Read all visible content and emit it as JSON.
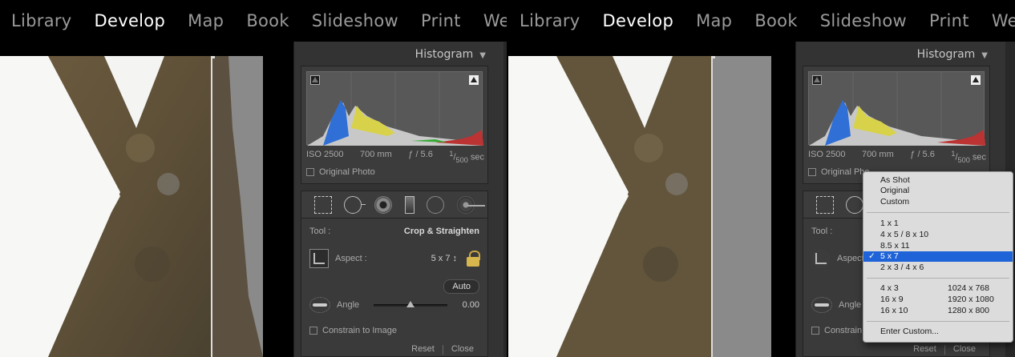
{
  "modules": [
    "Library",
    "Develop",
    "Map",
    "Book",
    "Slideshow",
    "Print",
    "Web"
  ],
  "active_module": "Develop",
  "histogram": {
    "title": "Histogram",
    "iso": "ISO 2500",
    "focal": "700 mm",
    "aperture": "ƒ / 5.6",
    "shutter_num": "1",
    "shutter_den": "500",
    "shutter_unit": "sec",
    "original_photo": "Original Photo"
  },
  "crop": {
    "tool_label": "Tool :",
    "tool_value": "Crop & Straighten",
    "aspect_label": "Aspect :",
    "aspect_value": "5 x 7 ↕",
    "auto_label": "Auto",
    "angle_label": "Angle",
    "angle_value": "0.00",
    "constrain_label": "Constrain to Image",
    "angle_fraction": 0.5
  },
  "footer": {
    "reset": "Reset",
    "close": "Close"
  },
  "aspect_menu": {
    "group1": [
      "As Shot",
      "Original",
      "Custom"
    ],
    "group2": [
      "1 x 1",
      "4 x 5  /  8 x 10",
      "8.5 x 11",
      "5 x 7",
      "2 x 3  /  4 x 6"
    ],
    "selected": "5 x 7",
    "group3_left": [
      "4 x 3",
      "16 x 9",
      "16 x 10"
    ],
    "group3_right": [
      "1024 x 768",
      "1920 x 1080",
      "1280 x 800"
    ],
    "enter_custom": "Enter Custom...",
    "check": "✓"
  },
  "right_partial": {
    "original_photo": "Original Pho",
    "aspect_label": "Aspect",
    "constrain_label": "Constrain"
  },
  "colors": {
    "accent": "#1f63d8",
    "lock": "#d8b64e",
    "panel": "#333333"
  }
}
